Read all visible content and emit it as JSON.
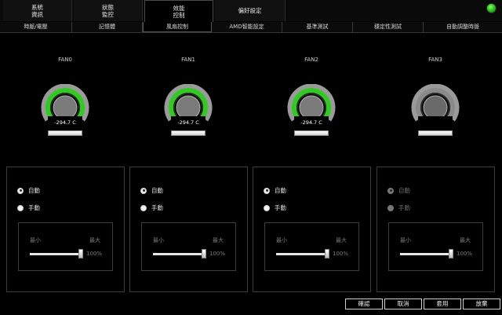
{
  "window": {
    "tabs": [
      {
        "line1": "系統",
        "line2": "資訊"
      },
      {
        "line1": "狀態",
        "line2": "監控"
      },
      {
        "line1": "效能",
        "line2": "控制"
      },
      {
        "line1": "偏好設定",
        "line2": ""
      }
    ],
    "status_led_color": "#1fbf10"
  },
  "subnav": {
    "items": [
      "時脈/電壓",
      "記憶體",
      "風扇控制",
      "AMD智能設定",
      "基準測試",
      "穩定性測試",
      "自動調整時脈"
    ]
  },
  "fans": [
    {
      "name": "FAN0",
      "temp": "-294.7 C",
      "active": true,
      "level": 1.0
    },
    {
      "name": "FAN1",
      "temp": "-294.7 C",
      "active": true,
      "level": 1.0
    },
    {
      "name": "FAN2",
      "temp": "-294.7 C",
      "active": true,
      "level": 1.0
    },
    {
      "name": "FAN3",
      "temp": "",
      "active": false,
      "level": 0.0
    }
  ],
  "controls": {
    "auto_label": "自動",
    "manual_label": "手動",
    "min_label": "最小",
    "max_label": "最大",
    "percent_label": "100%",
    "panels": [
      {
        "mode": "auto",
        "slider_value": 100,
        "enabled": true
      },
      {
        "mode": "auto",
        "slider_value": 100,
        "enabled": true
      },
      {
        "mode": "auto",
        "slider_value": 100,
        "enabled": true
      },
      {
        "mode": "auto",
        "slider_value": 100,
        "enabled": false
      }
    ]
  },
  "footer": {
    "confirm": "確認",
    "cancel": "取消",
    "apply": "套用",
    "discard": "放棄"
  },
  "colors": {
    "gauge_green": "#2ecc1f",
    "gauge_gray": "#8a8a8a"
  }
}
